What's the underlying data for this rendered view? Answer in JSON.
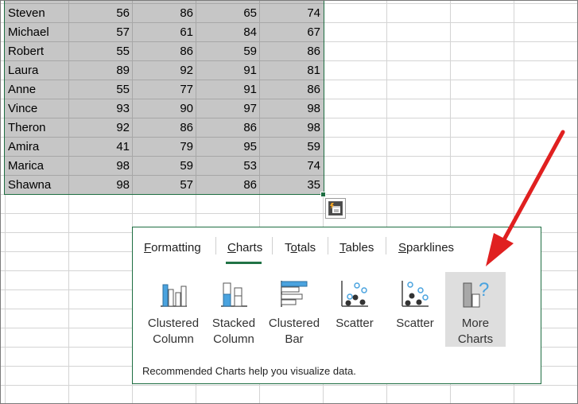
{
  "sheet": {
    "rows": [
      {
        "name": "Steven",
        "values": [
          56,
          86,
          65,
          74
        ]
      },
      {
        "name": "Michael",
        "values": [
          57,
          61,
          84,
          67
        ]
      },
      {
        "name": "Robert",
        "values": [
          55,
          86,
          59,
          86
        ]
      },
      {
        "name": "Laura",
        "values": [
          89,
          92,
          91,
          81
        ]
      },
      {
        "name": "Anne",
        "values": [
          55,
          77,
          91,
          86
        ]
      },
      {
        "name": "Vince",
        "values": [
          93,
          90,
          97,
          98
        ]
      },
      {
        "name": "Theron",
        "values": [
          92,
          86,
          86,
          98
        ]
      },
      {
        "name": "Amira",
        "values": [
          41,
          79,
          95,
          59
        ]
      },
      {
        "name": "Marica",
        "values": [
          98,
          59,
          53,
          74
        ]
      },
      {
        "name": "Shawna",
        "values": [
          98,
          57,
          86,
          35
        ]
      }
    ]
  },
  "quick_analysis": {
    "tabs": [
      {
        "pre": "",
        "u": "F",
        "post": "ormatting"
      },
      {
        "pre": "",
        "u": "C",
        "post": "harts"
      },
      {
        "pre": "T",
        "u": "o",
        "post": "tals"
      },
      {
        "pre": "",
        "u": "T",
        "post": "ables"
      },
      {
        "pre": "",
        "u": "S",
        "post": "parklines"
      }
    ],
    "active_tab": "Charts",
    "charts": [
      {
        "line1": "Clustered",
        "line2": "Column",
        "icon": "clustered-column-icon"
      },
      {
        "line1": "Stacked",
        "line2": "Column",
        "icon": "stacked-column-icon"
      },
      {
        "line1": "Clustered",
        "line2": "Bar",
        "icon": "clustered-bar-icon"
      },
      {
        "line1": "Scatter",
        "line2": "",
        "icon": "scatter-icon"
      },
      {
        "line1": "Scatter",
        "line2": "",
        "icon": "scatter-icon"
      },
      {
        "line1": "More",
        "line2": "Charts",
        "icon": "more-charts-icon"
      }
    ],
    "hint": "Recommended Charts help you visualize data.",
    "colors": {
      "accent": "#217346",
      "red_arrow": "#e02020",
      "icon_blue": "#4aa3df"
    }
  }
}
